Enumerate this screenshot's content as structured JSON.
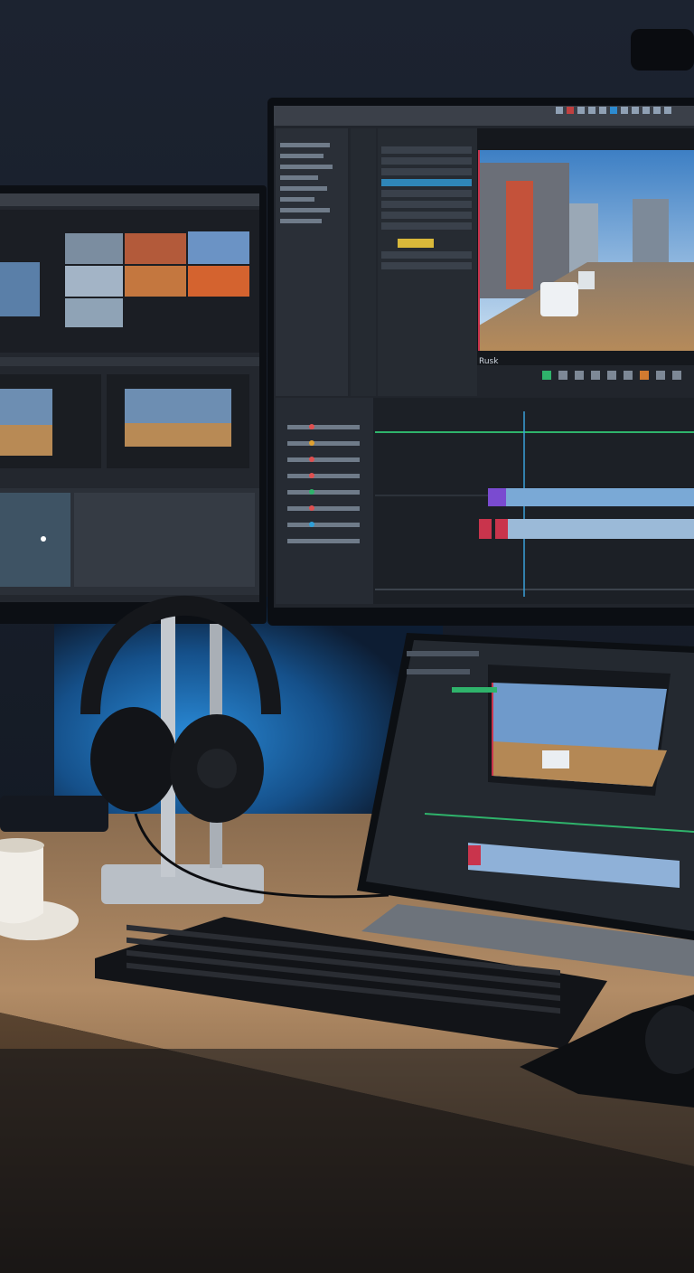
{
  "scene": {
    "description_label": "",
    "colors": {
      "wall": "#1a2433",
      "backlight": "#1f6fb8",
      "desk": "#b08a63",
      "monitor_bezel": "#0c0f14",
      "ui_panel": "#2a2f38",
      "ui_dark": "#1d2128",
      "timeline_green": "#2fb36b",
      "playhead": "#3aa0d8",
      "clip_red": "#c9344c",
      "clip_purple": "#7a4bd0",
      "clip_blue": "#7aa9d6",
      "accent_yellow": "#d9b93a"
    }
  },
  "main_monitor": {
    "viewer_label": "Rusk",
    "icons": [
      "play-icon",
      "stop-icon",
      "loop-icon",
      "fullscreen-icon"
    ]
  },
  "objects": {
    "headphones": "headphones-icon",
    "coffee_cup": "cup-icon",
    "keyboard": "keyboard-icon",
    "mouse": "mouse-icon"
  }
}
